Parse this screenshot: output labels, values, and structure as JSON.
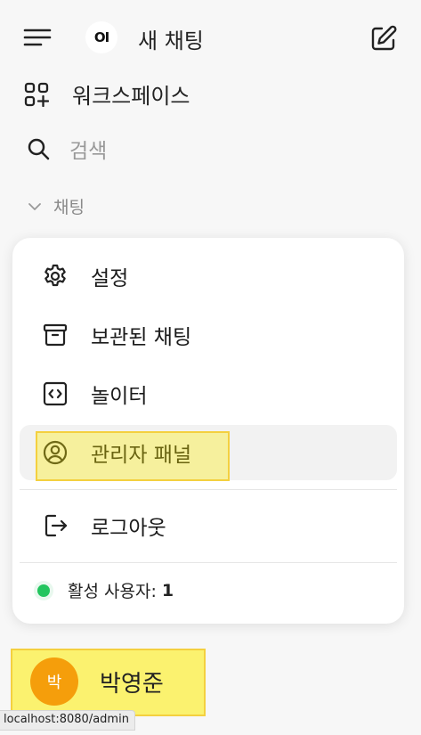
{
  "header": {
    "logo_text": "OI",
    "new_chat_label": "새 채팅"
  },
  "nav": {
    "workspace_label": "워크스페이스",
    "search_label": "검색",
    "chats_label": "채팅"
  },
  "menu": {
    "settings_label": "설정",
    "archived_label": "보관된 채팅",
    "playground_label": "놀이터",
    "admin_label": "관리자 패널",
    "logout_label": "로그아웃"
  },
  "active_users": {
    "label": "활성 사용자:",
    "count": "1"
  },
  "user": {
    "avatar_text": "박",
    "name": "박영준"
  },
  "status_url": "localhost:8080/admin",
  "colors": {
    "active_dot": "#22c55e",
    "avatar_bg": "#f59e0b",
    "highlight": "#ffee00"
  }
}
